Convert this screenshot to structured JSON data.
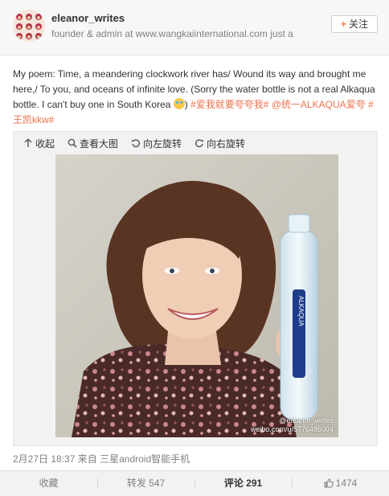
{
  "header": {
    "username": "eleanor_writes",
    "description": "founder & admin at www.wangkaiinternational.com just a",
    "follow_label": "关注"
  },
  "post": {
    "text": "My poem: Time, a meandering clockwork river has/ Wound its way and brought me here,/ To you, and oceans of infinite love. (Sorry the water bottle is not a real Alkaqua bottle. I can't buy one in South Korea ",
    "tag1": "#爱我就要夸夸我#",
    "mention": "@统一ALKAQUA爱夸",
    "tag2": "#王凯kkw#"
  },
  "media_toolbar": {
    "collapse": "收起",
    "view_large": "查看大图",
    "rotate_left": "向左旋转",
    "rotate_right": "向右旋转"
  },
  "photo": {
    "bottle_label": "ALKAQUA",
    "watermark_user": "@eleanor_writes",
    "watermark_url": "weibo.com/u/5776486004"
  },
  "meta": {
    "time": "2月27日 18:37",
    "source_prefix": "来自",
    "source": "三星android智能手机"
  },
  "actions": {
    "favorite": "收藏",
    "repost": "转发 547",
    "comment": "评论 291",
    "like": "1474"
  },
  "colors": {
    "tag": "#eb7350",
    "follow_plus": "#f77c3d",
    "muted": "#808080"
  },
  "icons": [
    "collapse-icon",
    "magnifier-icon",
    "rotate-left-icon",
    "rotate-right-icon",
    "thumbs-up-icon",
    "crying-emoji-icon"
  ]
}
